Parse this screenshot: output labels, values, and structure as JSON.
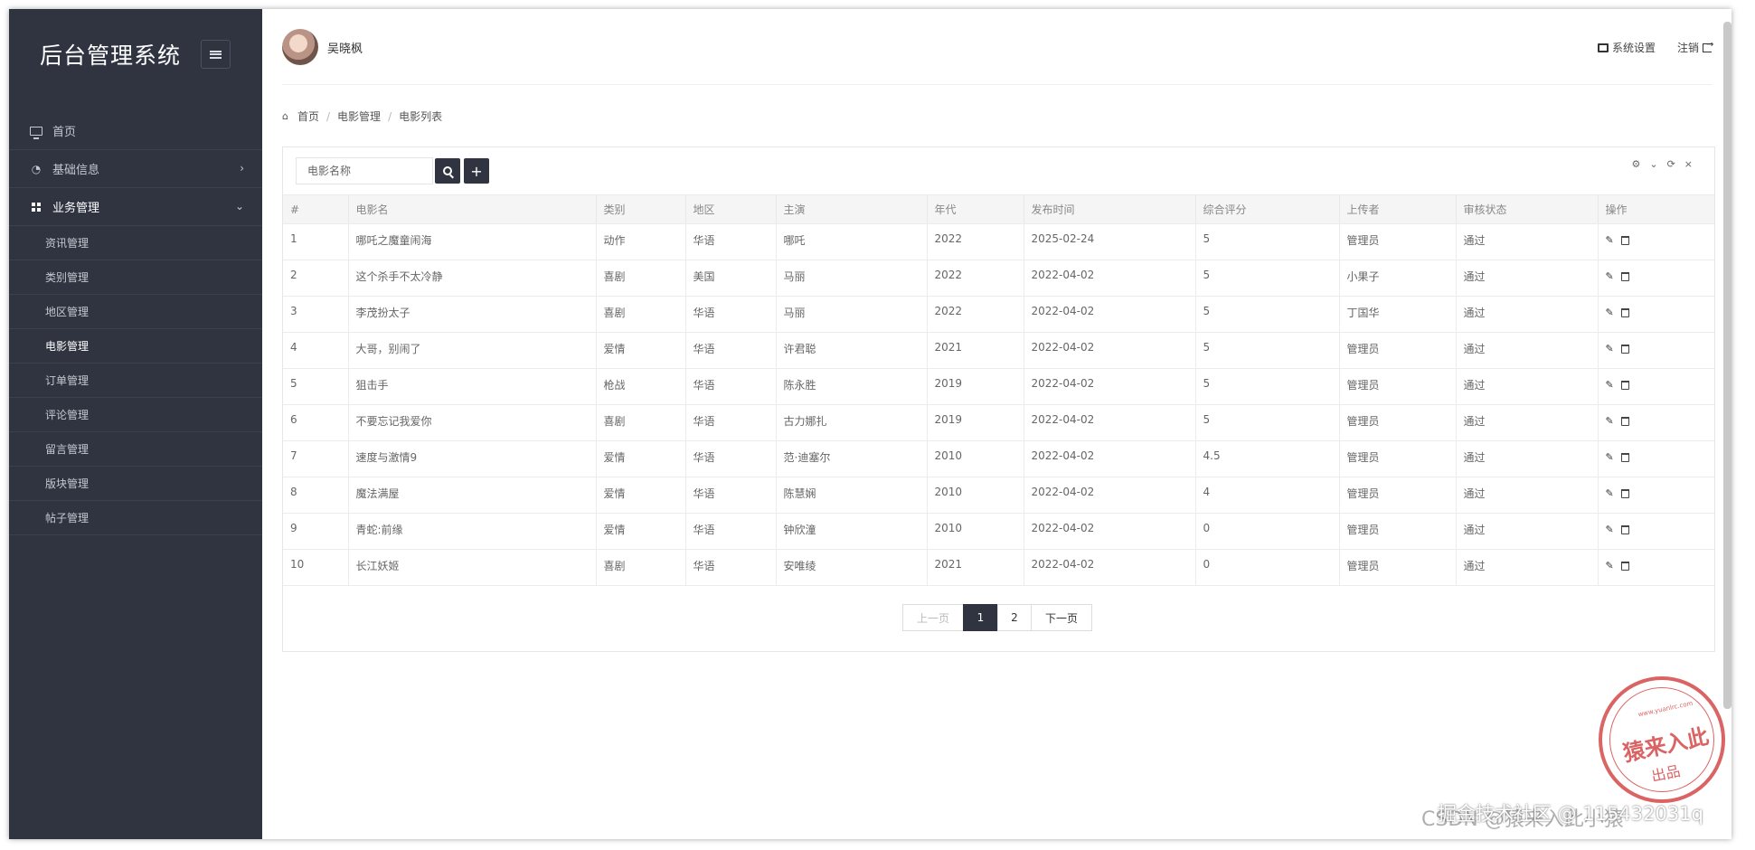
{
  "app": {
    "title": "后台管理系统"
  },
  "user": {
    "name": "吴晓枫"
  },
  "top_actions": {
    "settings": "系统设置",
    "logout": "注销"
  },
  "sidebar": {
    "items": [
      {
        "label": "首页"
      },
      {
        "label": "基础信息"
      },
      {
        "label": "业务管理"
      }
    ],
    "sub_items": [
      {
        "label": "资讯管理"
      },
      {
        "label": "类别管理"
      },
      {
        "label": "地区管理"
      },
      {
        "label": "电影管理"
      },
      {
        "label": "订单管理"
      },
      {
        "label": "评论管理"
      },
      {
        "label": "留言管理"
      },
      {
        "label": "版块管理"
      },
      {
        "label": "帖子管理"
      }
    ]
  },
  "breadcrumb": [
    "首页",
    "电影管理",
    "电影列表"
  ],
  "search": {
    "placeholder": "电影名称"
  },
  "table": {
    "headers": [
      "#",
      "电影名",
      "类别",
      "地区",
      "主演",
      "年代",
      "发布时间",
      "综合评分",
      "上传者",
      "审核状态",
      "操作"
    ],
    "rows": [
      [
        "1",
        "哪吒之魔童闹海",
        "动作",
        "华语",
        "哪吒",
        "2022",
        "2025-02-24",
        "5",
        "管理员",
        "通过"
      ],
      [
        "2",
        "这个杀手不太冷静",
        "喜剧",
        "美国",
        "马丽",
        "2022",
        "2022-04-02",
        "5",
        "小果子",
        "通过"
      ],
      [
        "3",
        "李茂扮太子",
        "喜剧",
        "华语",
        "马丽",
        "2022",
        "2022-04-02",
        "5",
        "丁国华",
        "通过"
      ],
      [
        "4",
        "大哥，别闹了",
        "爱情",
        "华语",
        "许君聪",
        "2021",
        "2022-04-02",
        "5",
        "管理员",
        "通过"
      ],
      [
        "5",
        "狙击手",
        "枪战",
        "华语",
        "陈永胜",
        "2019",
        "2022-04-02",
        "5",
        "管理员",
        "通过"
      ],
      [
        "6",
        "不要忘记我爱你",
        "喜剧",
        "华语",
        "古力娜扎",
        "2019",
        "2022-04-02",
        "5",
        "管理员",
        "通过"
      ],
      [
        "7",
        "速度与激情9",
        "爱情",
        "华语",
        "范·迪塞尔",
        "2010",
        "2022-04-02",
        "4.5",
        "管理员",
        "通过"
      ],
      [
        "8",
        "魔法满屋",
        "爱情",
        "华语",
        "陈慧娴",
        "2010",
        "2022-04-02",
        "4",
        "管理员",
        "通过"
      ],
      [
        "9",
        "青蛇:前缘",
        "爱情",
        "华语",
        "钟欣潼",
        "2010",
        "2022-04-02",
        "0",
        "管理员",
        "通过"
      ],
      [
        "10",
        "长江妖姬",
        "喜剧",
        "华语",
        "安唯绫",
        "2021",
        "2022-04-02",
        "0",
        "管理员",
        "通过"
      ]
    ]
  },
  "pagination": {
    "prev": "上一页",
    "pages": [
      "1",
      "2"
    ],
    "current": "1",
    "next": "下一页"
  },
  "stamp": {
    "main": "猿来入此",
    "sub": "出品",
    "url": "www.yuanlrc.com"
  },
  "watermark": "掘金技术社区 @ 115432031q",
  "watermark_under": "CSDN @猿来入此小猿",
  "colors": {
    "sidebar_bg": "#2f3440",
    "accent": "#2f3440",
    "stamp_red": "#d44a4a"
  }
}
